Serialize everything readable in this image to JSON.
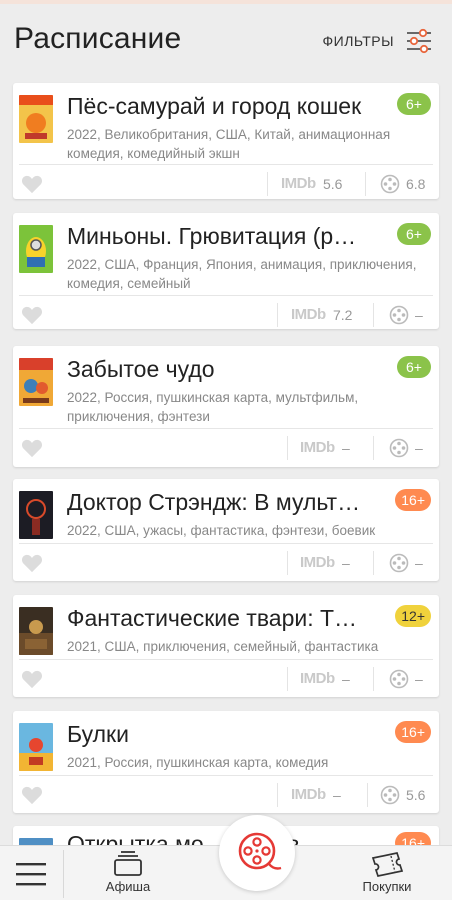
{
  "header": {
    "title": "Расписание",
    "filters_label": "ФИЛЬТРЫ",
    "filters_icon": "sliders-icon"
  },
  "colors": {
    "age_green": "#8bc34a",
    "age_orange": "#ff8a50",
    "age_yellow": "#f0d23c",
    "accent": "#e53935"
  },
  "movies": [
    {
      "title": "Пёс-самурай и город кошек",
      "age": "6+",
      "meta": "2022, Великобритания, США, Китай, анимационная комедия, комедийный экшн",
      "imdb_label": "IMDb",
      "imdb": "5.6",
      "kp": "6.8"
    },
    {
      "title": "Миньоны. Грювитация  (р…",
      "age": "6+",
      "meta": "2022, США, Франция, Япония, анимация, приключения, комедия, семейный",
      "imdb_label": "IMDb",
      "imdb": "7.2",
      "kp": "–"
    },
    {
      "title": "Забытое чудо",
      "age": "6+",
      "meta": "2022, Россия, пушкинская карта, мультфильм, приключения, фэнтези",
      "imdb_label": "IMDb",
      "imdb": "–",
      "kp": "–"
    },
    {
      "title": "Доктор Стрэндж: В мульт…",
      "age": "16+",
      "meta": "2022, США, ужасы, фантастика, фэнтези, боевик",
      "imdb_label": "IMDb",
      "imdb": "–",
      "kp": "–"
    },
    {
      "title": "Фантастические твари: Т…",
      "age": "12+",
      "meta": "2021, США, приключения, семейный, фантастика",
      "imdb_label": "IMDb",
      "imdb": "–",
      "kp": "–"
    },
    {
      "title": "Булки",
      "age": "16+",
      "meta": "2021, Россия, пушкинская карта, комедия",
      "imdb_label": "IMDb",
      "imdb": "–",
      "kp": "5.6"
    },
    {
      "title": "Открытка мо…       автр в",
      "age": "16+"
    }
  ],
  "bottom_nav": {
    "menu_icon": "hamburger-menu-icon",
    "afisha": "Афиша",
    "center_icon": "film-reel-icon",
    "purchases": "Покупки"
  }
}
